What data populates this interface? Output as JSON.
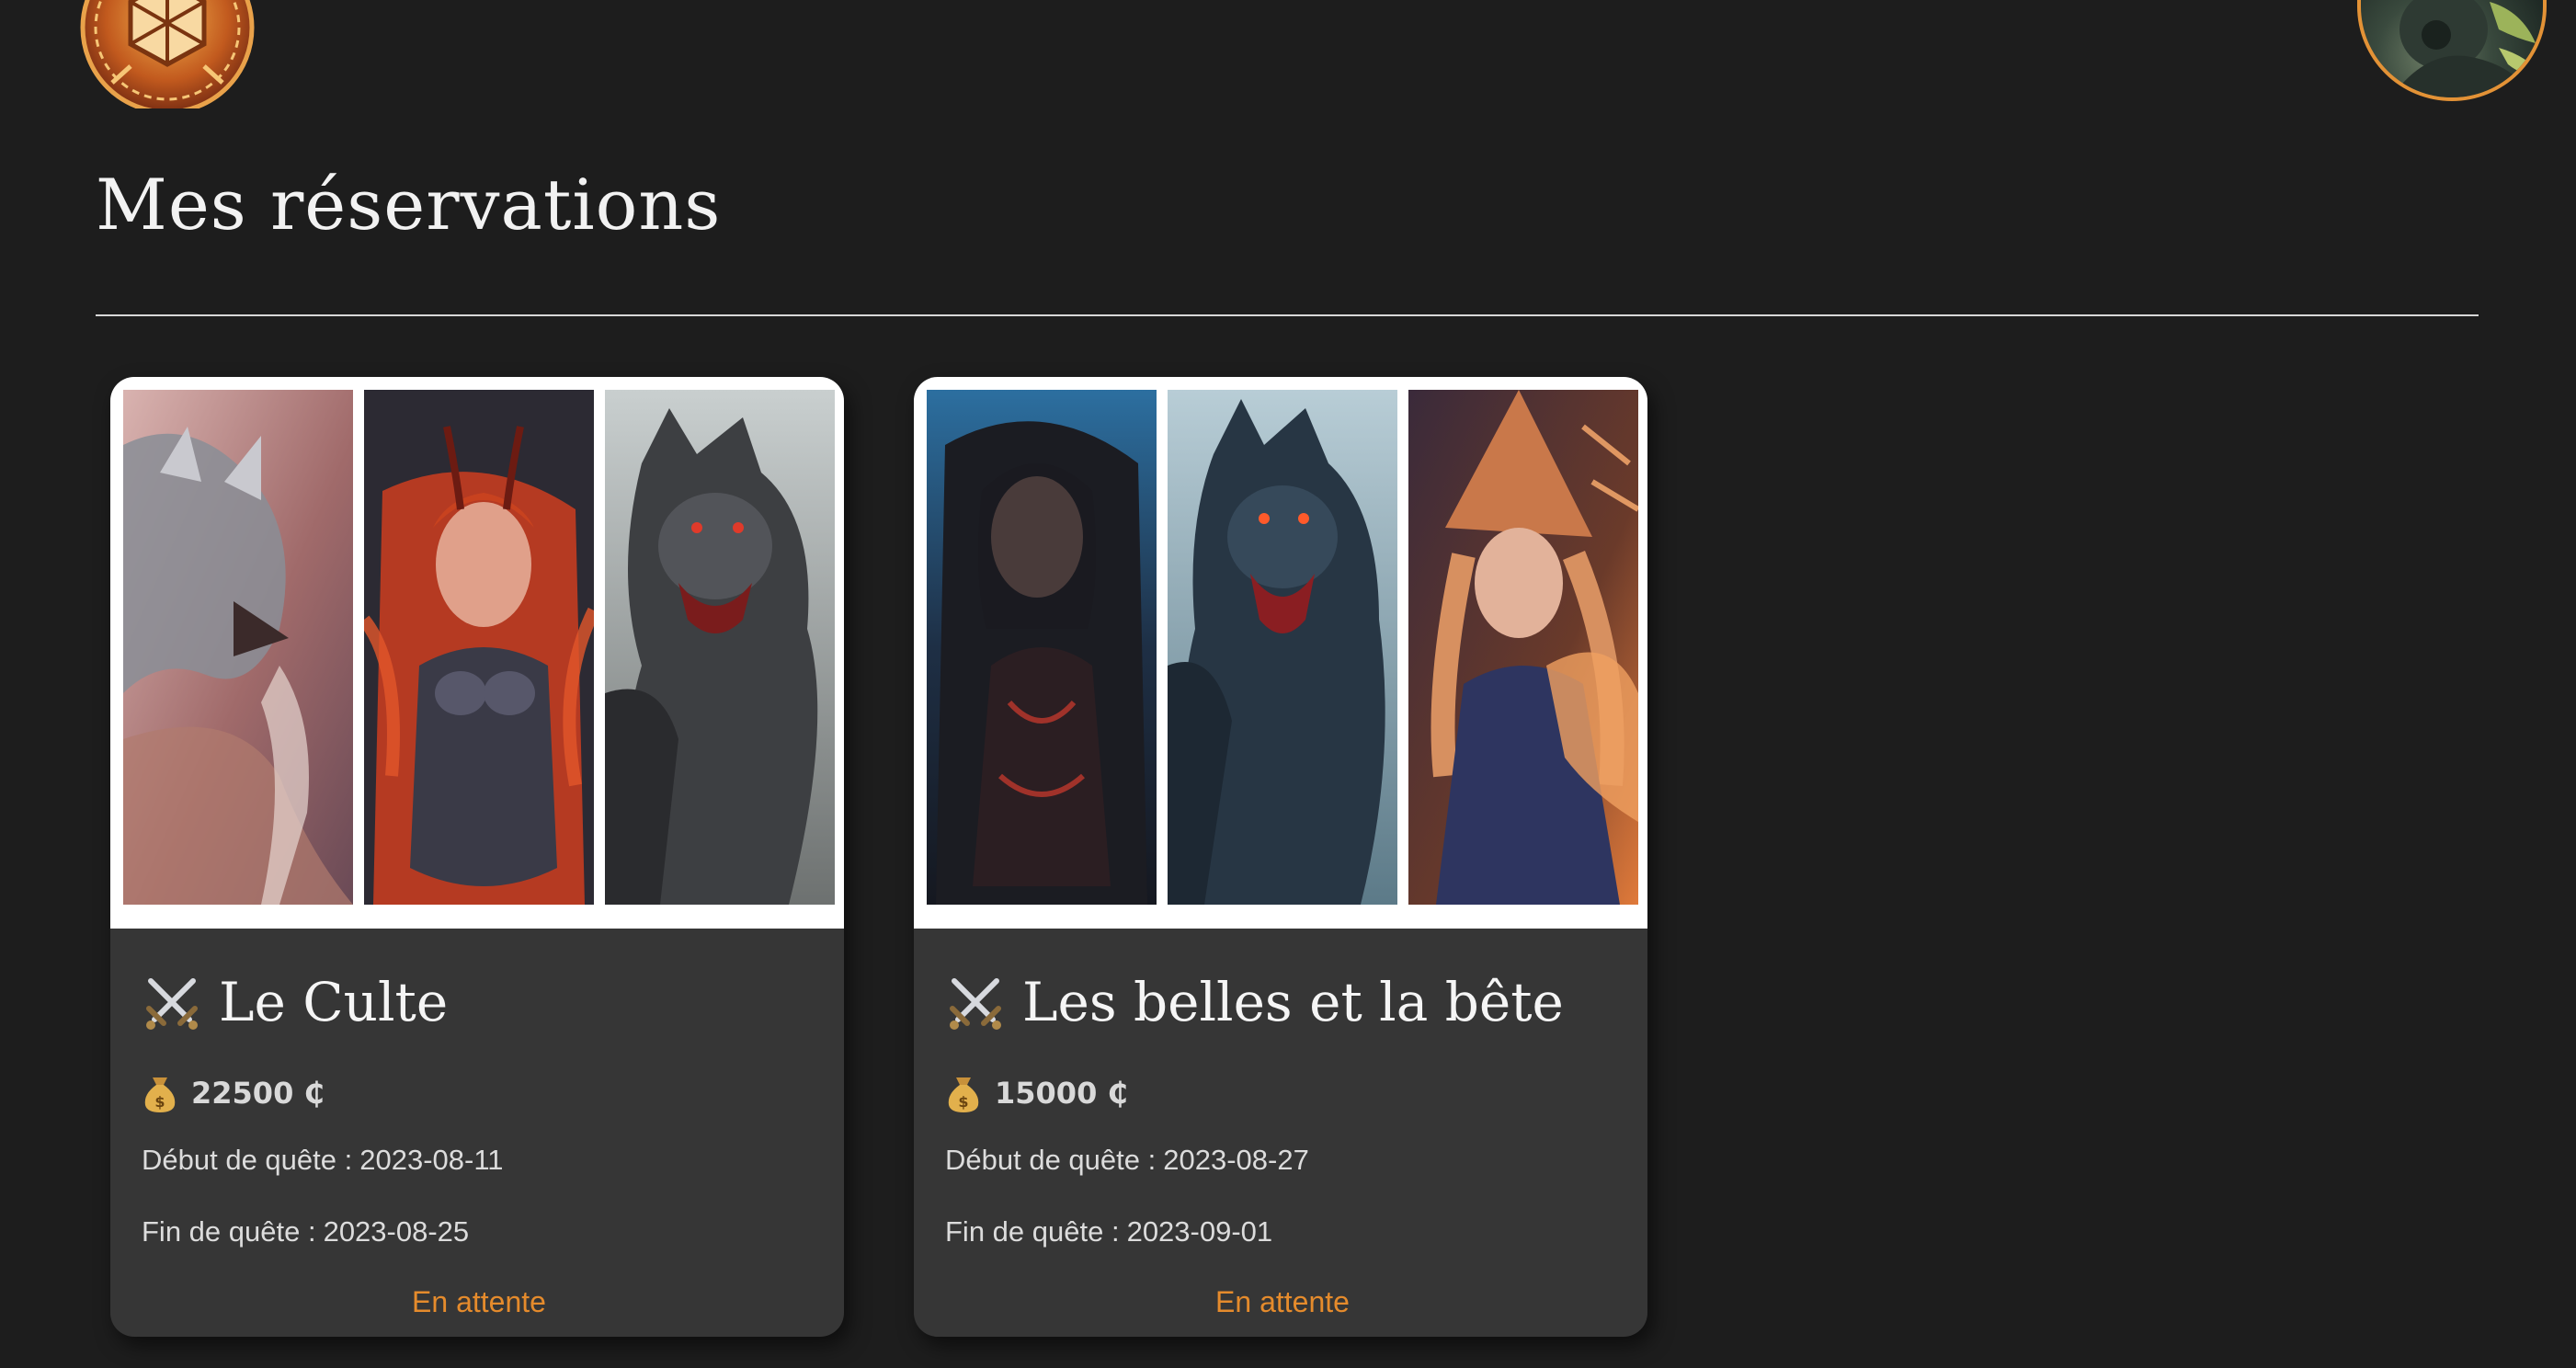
{
  "header": {
    "logo_icon": "celtic-shield-logo-icon",
    "avatar_icon": "user-avatar"
  },
  "page": {
    "title": "Mes réservations"
  },
  "reservations": [
    {
      "icon": "crossed-swords-icon",
      "title": "Le Culte",
      "price": "22500 ₵",
      "price_icon": "money-bag-icon",
      "start_label": "Début de quête :",
      "start_date": "2023-08-11",
      "end_label": "Fin de quête :",
      "end_date": "2023-08-25",
      "status": "En attente",
      "gallery": [
        "dragon-artwork",
        "red-haired-warrior-artwork",
        "werewolf-artwork"
      ]
    },
    {
      "icon": "crossed-swords-icon",
      "title": "Les belles et la bête",
      "price": "15000 ₵",
      "price_icon": "money-bag-icon",
      "start_label": "Début de quête :",
      "start_date": "2023-08-27",
      "end_label": "Fin de quête :",
      "end_date": "2023-09-01",
      "status": "En attente",
      "gallery": [
        "dark-sorceress-artwork",
        "blue-werewolf-artwork",
        "fire-witch-artwork"
      ]
    }
  ],
  "colors": {
    "background": "#1d1d1d",
    "card_background": "#363636",
    "status_pending": "#e58b2c",
    "avatar_border": "#e39236"
  }
}
